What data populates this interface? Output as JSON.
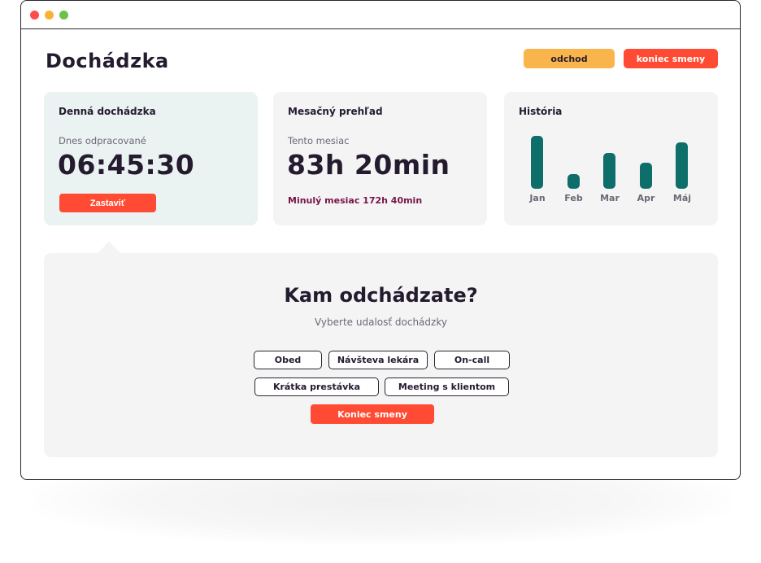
{
  "header": {
    "title": "Dochádzka",
    "odchod_label": "odchod",
    "koniec_label": "koniec smeny"
  },
  "daily": {
    "title": "Denná dochádzka",
    "subtitle": "Dnes odpracované",
    "time": "06:45:30",
    "stop_label": "Zastaviť"
  },
  "monthly": {
    "title": "Mesačný prehľad",
    "subtitle": "Tento mesiac",
    "value": "83h 20min",
    "last_month": "Minulý mesiac 172h 40min"
  },
  "history": {
    "title": "História",
    "bar_color": "#0d6e6a",
    "months": [
      "Jan",
      "Feb",
      "Mar",
      "Apr",
      "Máj"
    ],
    "levels": [
      1.0,
      0.28,
      0.68,
      0.49,
      0.87
    ]
  },
  "leave_panel": {
    "title": "Kam odchádzate?",
    "subtitle": "Vyberte udalosť dochádzky",
    "options": [
      "Obed",
      "Návšteva lekára",
      "On-call",
      "Krátka prestávka",
      "Meeting s klientom"
    ],
    "end_label": "Koniec smeny"
  },
  "colors": {
    "accent_red": "#ff4b33",
    "accent_yellow": "#f9b54c",
    "teal": "#0d6e6a",
    "wine": "#7a1446"
  }
}
